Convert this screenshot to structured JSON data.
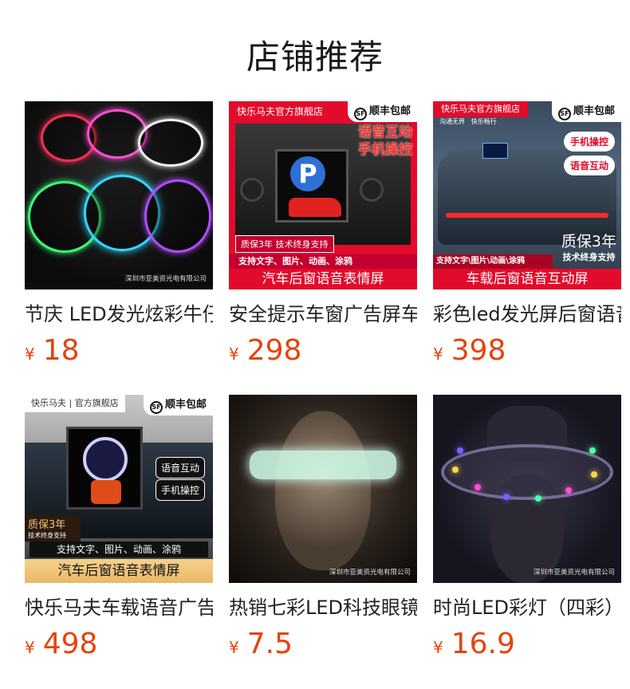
{
  "section_title": "店铺推荐",
  "currency": "¥",
  "products": [
    {
      "name": "节庆 LED发光炫彩牛仔帽",
      "price": "18",
      "image": {
        "watermark": "深圳市亚美资光电有限公司"
      }
    },
    {
      "name": "安全提示车窗广告屏车载",
      "price": "298",
      "image": {
        "store": "快乐马夫官方旗舰店",
        "shipping": "顺丰包邮",
        "headline_1": "语音互动",
        "headline_2": "手机操控",
        "warranty": "质保3年 技术终身支持",
        "features": "支持文字、图片、动画、涂鸦",
        "banner": "汽车后窗语音表情屏",
        "panel_letter": "P"
      }
    },
    {
      "name": "彩色led发光屏后窗语音",
      "price": "398",
      "image": {
        "store": "快乐马夫官方旗舰店",
        "tagline_1": "沟通无界",
        "tagline_2": "快乐畅行",
        "shipping": "顺丰包邮",
        "pill_1": "手机操控",
        "pill_2": "语音互动",
        "warranty_big": "质保3年",
        "warranty_small": "技术终身支持",
        "features": "支持文字\\图片\\动画\\涂鸦",
        "banner": "车载后窗语音互动屏"
      }
    },
    {
      "name": "快乐马夫车载语音广告屏",
      "price": "498",
      "image": {
        "store": "快乐马夫 | 官方旗舰店",
        "shipping": "顺丰包邮",
        "pill_1": "语音互动",
        "pill_2": "手机操控",
        "warranty_big": "质保3年",
        "warranty_small": "技术终身支持",
        "features": "支持文字、图片、动画、涂鸦",
        "banner": "汽车后窗语音表情屏"
      }
    },
    {
      "name": "热销七彩LED科技眼镜",
      "price": "7.5",
      "image": {
        "watermark": "深圳市亚美资光电有限公司"
      }
    },
    {
      "name": "时尚LED彩灯（四彩）",
      "price": "16.9",
      "image": {
        "watermark": "深圳市亚美资光电有限公司"
      }
    }
  ]
}
